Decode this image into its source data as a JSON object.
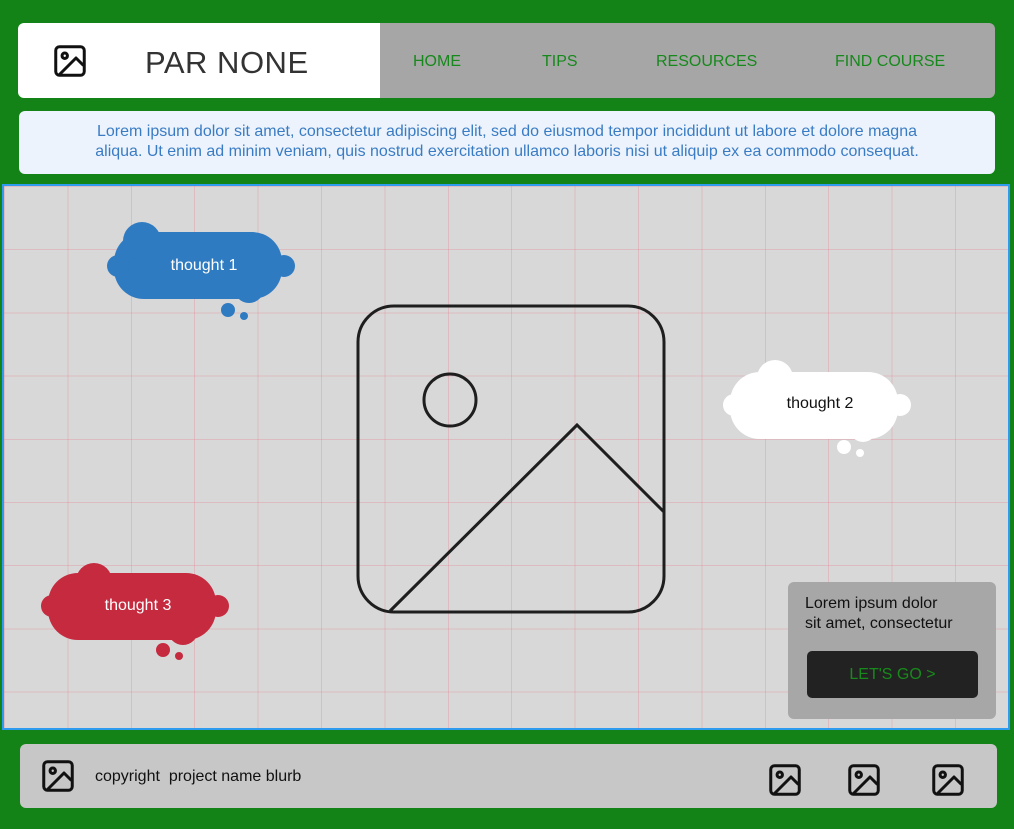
{
  "brand": {
    "name": "PAR NONE",
    "logo_icon": "image-icon"
  },
  "nav": {
    "items": [
      {
        "label": "HOME"
      },
      {
        "label": "TIPS"
      },
      {
        "label": "RESOURCES"
      },
      {
        "label": "FIND COURSE"
      }
    ]
  },
  "banner": {
    "line1": "Lorem ipsum dolor sit amet, consectetur adipiscing elit, sed do eiusmod tempor incididunt ut labore et dolore magna",
    "line2": "aliqua. Ut enim ad minim veniam, quis nostrud exercitation ullamco laboris nisi ut aliquip ex ea commodo consequat."
  },
  "thoughts": [
    {
      "label": "thought 1",
      "color": "#2f7bc2",
      "text_color": "#ffffff"
    },
    {
      "label": "thought 2",
      "color": "#ffffff",
      "text_color": "#111111"
    },
    {
      "label": "thought 3",
      "color": "#c52a3f",
      "text_color": "#ffffff"
    }
  ],
  "hero": {
    "icon": "image-placeholder-icon"
  },
  "cta": {
    "text_line1": "Lorem ipsum dolor",
    "text_line2": "sit amet, consectetur",
    "button_label": "LET'S GO >"
  },
  "footer": {
    "text": "copyright  project name blurb",
    "logo_icon": "image-icon",
    "social_icons": [
      "image-icon",
      "image-icon",
      "image-icon"
    ]
  },
  "colors": {
    "frame_green": "#138317",
    "nav_gray": "#a6a6a6",
    "nav_text_green": "#17881c",
    "banner_bg": "#ecf3fc",
    "banner_text": "#3a7cc4",
    "main_bg": "#d8d8d8",
    "main_border": "#2e9bef"
  }
}
